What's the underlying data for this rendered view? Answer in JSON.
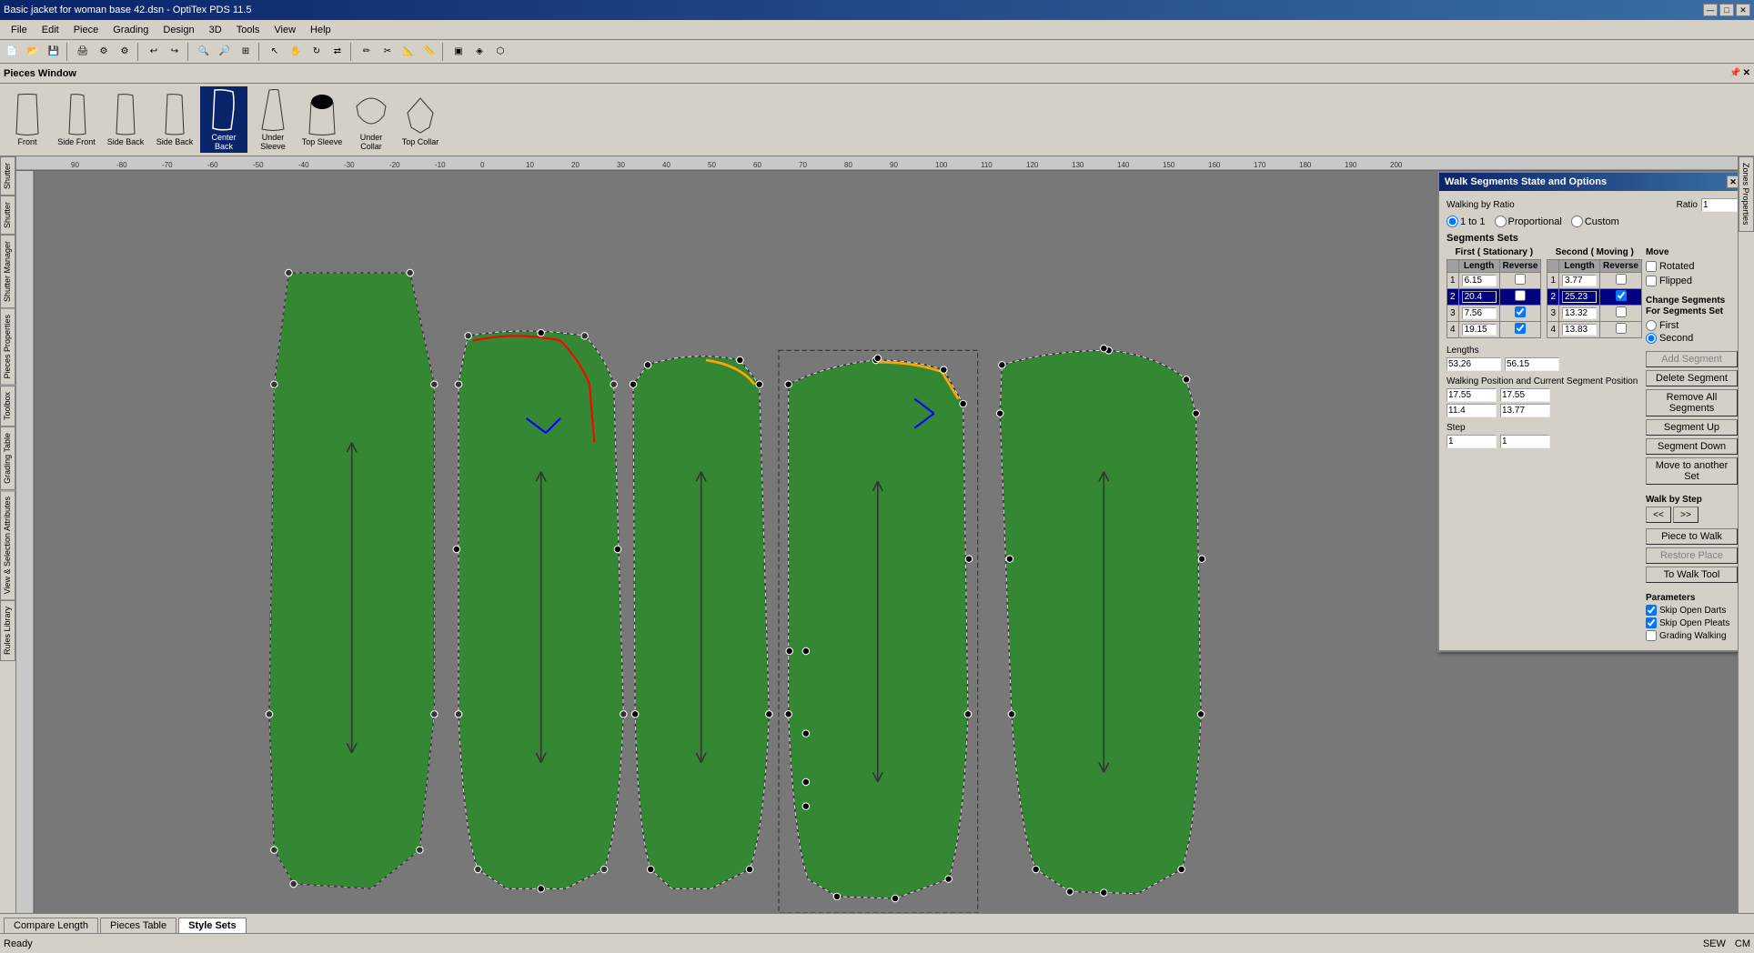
{
  "titlebar": {
    "title": "Basic jacket for woman base 42.dsn - OptiTex PDS 11.5",
    "minimize": "—",
    "maximize": "□",
    "close": "✕"
  },
  "menubar": {
    "items": [
      "File",
      "Edit",
      "Piece",
      "Grading",
      "Design",
      "3D",
      "Tools",
      "View",
      "Help"
    ]
  },
  "pieces_window": {
    "label": "Pieces Window",
    "pieces": [
      {
        "name": "Front",
        "id": "front"
      },
      {
        "name": "Side Front",
        "id": "side-front"
      },
      {
        "name": "Side Back",
        "id": "side-back"
      },
      {
        "name": "Side Back",
        "id": "side-back-2"
      },
      {
        "name": "Center Back",
        "id": "center-back"
      },
      {
        "name": "Under Sleeve",
        "id": "under-sleeve"
      },
      {
        "name": "Top Sleeve",
        "id": "top-sleeve"
      },
      {
        "name": "Under Collar",
        "id": "under-collar"
      },
      {
        "name": "Top Collar",
        "id": "top-collar"
      }
    ]
  },
  "sidebar_left": {
    "tabs": [
      "Shutter",
      "Shutter",
      "Shutter Manager",
      "Pieces Properties",
      "Toolbox",
      "Grading Table",
      "View & Selection Attributes",
      "Rules Library"
    ]
  },
  "canvas": {
    "background": "#787878"
  },
  "bottom_tabs": [
    {
      "label": "Compare Length",
      "active": false
    },
    {
      "label": "Pieces Table",
      "active": false
    },
    {
      "label": "Style Sets",
      "active": true
    }
  ],
  "statusbar": {
    "ready": "Ready",
    "sew": "SEW",
    "unit": "CM"
  },
  "dialog": {
    "title": "Walk Segments State and Options",
    "walking_by_ratio": {
      "label": "Walking by Ratio",
      "ratio_label": "Ratio",
      "ratio_value": "1",
      "options": [
        "1 to 1",
        "Proportional",
        "Custom"
      ]
    },
    "segments_sets": {
      "label": "Segments Sets",
      "first_label": "First ( Stationary )",
      "second_label": "Second ( Moving )",
      "col_headers": [
        "",
        "Length",
        "Reverse"
      ],
      "first_rows": [
        {
          "id": "1",
          "length": "6.15",
          "reverse": false,
          "selected": false
        },
        {
          "id": "2",
          "length": "20.4",
          "reverse": false,
          "selected": true
        },
        {
          "id": "3",
          "length": "7.56",
          "reverse": true,
          "selected": false
        },
        {
          "id": "4",
          "length": "19.15",
          "reverse": true,
          "selected": false
        }
      ],
      "second_rows": [
        {
          "id": "1",
          "length": "3.77",
          "reverse": false,
          "selected": false
        },
        {
          "id": "2",
          "length": "25.23",
          "reverse": true,
          "selected": true
        },
        {
          "id": "3",
          "length": "13.32",
          "reverse": false,
          "selected": false
        },
        {
          "id": "4",
          "length": "13.83",
          "reverse": false,
          "selected": false
        }
      ]
    },
    "lengths": {
      "label": "Lengths",
      "first_value": "53.26",
      "second_value": "56.15"
    },
    "walking_position": {
      "label": "Walking Position and Current Segment Position",
      "first_pos1": "17.55",
      "second_pos1": "17.55",
      "first_pos2": "11.4",
      "second_pos2": "13.77"
    },
    "step": {
      "label": "Step",
      "first_value": "1",
      "second_value": "1"
    },
    "move": {
      "label": "Move",
      "rotated_label": "Rotated",
      "flipped_label": "Flipped"
    },
    "change_segments": {
      "label": "Change Segments For Segments Set",
      "first_label": "First",
      "second_label": "Second"
    },
    "buttons": {
      "add_segment": "Add Segment",
      "delete_segment": "Delete Segment",
      "remove_all": "Remove All Segments",
      "segment_up": "Segment Up",
      "segment_down": "Segment Down",
      "move_to_another": "Move to another Set",
      "walk_by_step_back": "<<",
      "walk_by_step_fwd": ">>",
      "piece_to_walk": "Piece to Walk",
      "restore_place": "Restore Place",
      "to_walk_tool": "To Walk Tool",
      "walk_by_step": "Walk by Step"
    },
    "parameters": {
      "label": "Parameters",
      "skip_open_darts": "Skip Open Darts",
      "skip_open_pleats": "Skip Open Pleats",
      "grading_walking": "Grading Walking",
      "skip_open_darts_checked": true,
      "skip_open_pleats_checked": true,
      "grading_walking_checked": false
    }
  }
}
